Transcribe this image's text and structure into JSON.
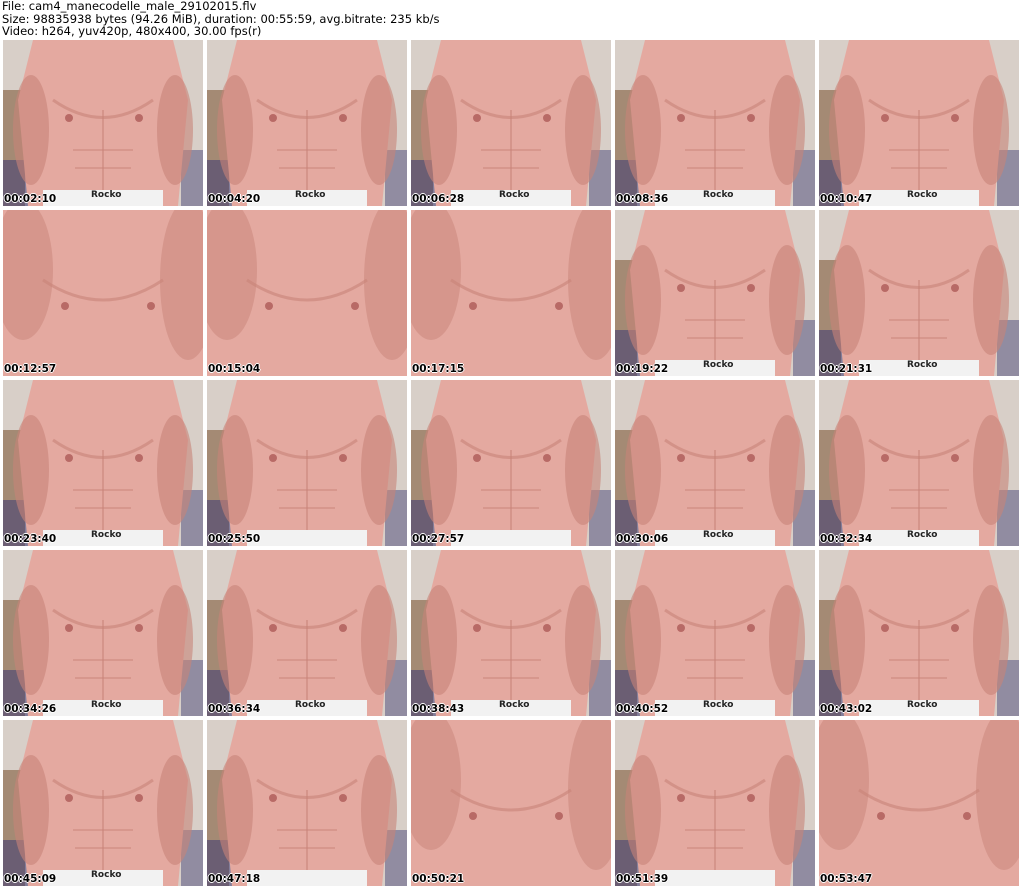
{
  "header": {
    "file_line": "File: cam4_manecodelle_male_29102015.flv",
    "size_line": "Size: 98835938 bytes (94.26 MiB), duration: 00:55:59, avg.bitrate: 235 kb/s",
    "video_line": "Video: h264, yuv420p, 480x400, 30.00 fps(r)"
  },
  "thumbnails": [
    {
      "timestamp": "00:02:10",
      "variant": "a",
      "brand": "Rocko"
    },
    {
      "timestamp": "00:04:20",
      "variant": "a",
      "brand": "Rocko"
    },
    {
      "timestamp": "00:06:28",
      "variant": "a",
      "brand": "Rocko"
    },
    {
      "timestamp": "00:08:36",
      "variant": "a",
      "brand": "Rocko"
    },
    {
      "timestamp": "00:10:47",
      "variant": "a",
      "brand": "Rocko"
    },
    {
      "timestamp": "00:12:57",
      "variant": "close",
      "brand": ""
    },
    {
      "timestamp": "00:15:04",
      "variant": "close",
      "brand": ""
    },
    {
      "timestamp": "00:17:15",
      "variant": "close",
      "brand": ""
    },
    {
      "timestamp": "00:19:22",
      "variant": "a",
      "brand": "Rocko"
    },
    {
      "timestamp": "00:21:31",
      "variant": "a",
      "brand": "Rocko"
    },
    {
      "timestamp": "00:23:40",
      "variant": "a",
      "brand": "Rocko"
    },
    {
      "timestamp": "00:25:50",
      "variant": "a",
      "brand": ""
    },
    {
      "timestamp": "00:27:57",
      "variant": "a",
      "brand": ""
    },
    {
      "timestamp": "00:30:06",
      "variant": "a",
      "brand": "Rocko"
    },
    {
      "timestamp": "00:32:34",
      "variant": "a",
      "brand": "Rocko"
    },
    {
      "timestamp": "00:34:26",
      "variant": "a",
      "brand": "Rocko"
    },
    {
      "timestamp": "00:36:34",
      "variant": "a",
      "brand": "Rocko"
    },
    {
      "timestamp": "00:38:43",
      "variant": "a",
      "brand": "Rocko"
    },
    {
      "timestamp": "00:40:52",
      "variant": "a",
      "brand": "Rocko"
    },
    {
      "timestamp": "00:43:02",
      "variant": "a",
      "brand": "Rocko"
    },
    {
      "timestamp": "00:45:09",
      "variant": "a",
      "brand": "Rocko"
    },
    {
      "timestamp": "00:47:18",
      "variant": "a",
      "brand": ""
    },
    {
      "timestamp": "00:50:21",
      "variant": "close",
      "brand": ""
    },
    {
      "timestamp": "00:51:39",
      "variant": "a",
      "brand": ""
    },
    {
      "timestamp": "00:53:47",
      "variant": "close",
      "brand": ""
    }
  ],
  "colors": {
    "wall": "#d8cfc8",
    "skin": "#e4a9a0",
    "skin_shadow": "#c88378",
    "shelf": "#7a5230",
    "blanket": "#3c3a72",
    "waistband": "#f2f2f2"
  }
}
